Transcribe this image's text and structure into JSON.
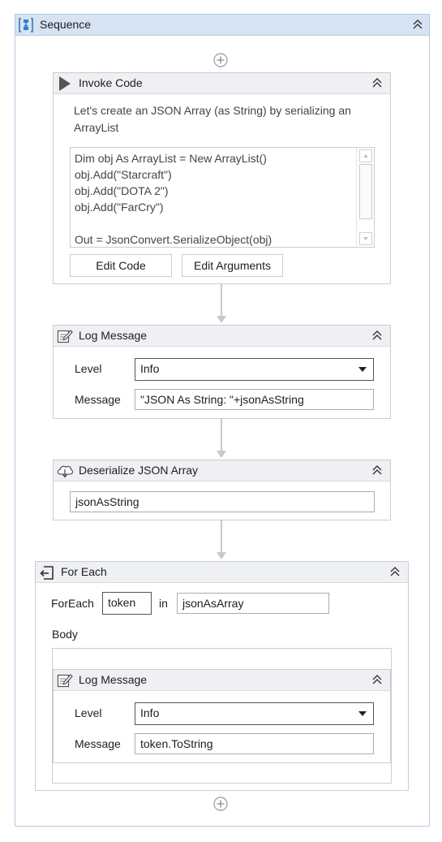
{
  "sequence": {
    "title": "Sequence"
  },
  "invoke_code": {
    "title": "Invoke Code",
    "description": "Let's create an JSON Array (as String) by serializing an ArrayList",
    "code_lines": [
      "Dim obj As ArrayList = New ArrayList()",
      "obj.Add(\"Starcraft\")",
      "obj.Add(\"DOTA 2\")",
      "obj.Add(\"FarCry\")",
      "",
      "Out = JsonConvert.SerializeObject(obj)"
    ],
    "edit_code_label": "Edit Code",
    "edit_arguments_label": "Edit Arguments"
  },
  "log_message_1": {
    "title": "Log Message",
    "level_label": "Level",
    "level_value": "Info",
    "message_label": "Message",
    "message_value": "\"JSON As String: \"+jsonAsString"
  },
  "deserialize": {
    "title": "Deserialize JSON Array",
    "input_value": "jsonAsString"
  },
  "for_each": {
    "title": "For Each",
    "foreach_label": "ForEach",
    "item_value": "token",
    "in_label": "in",
    "collection_value": "jsonAsArray",
    "body_label": "Body"
  },
  "log_message_2": {
    "title": "Log Message",
    "level_label": "Level",
    "level_value": "Info",
    "message_label": "Message",
    "message_value": "token.ToString"
  },
  "colors": {
    "sequence_header": "#d5e3f2",
    "activity_header": "#eef0f3",
    "border": "#c9cdd3",
    "connector": "#c8c8c8"
  }
}
